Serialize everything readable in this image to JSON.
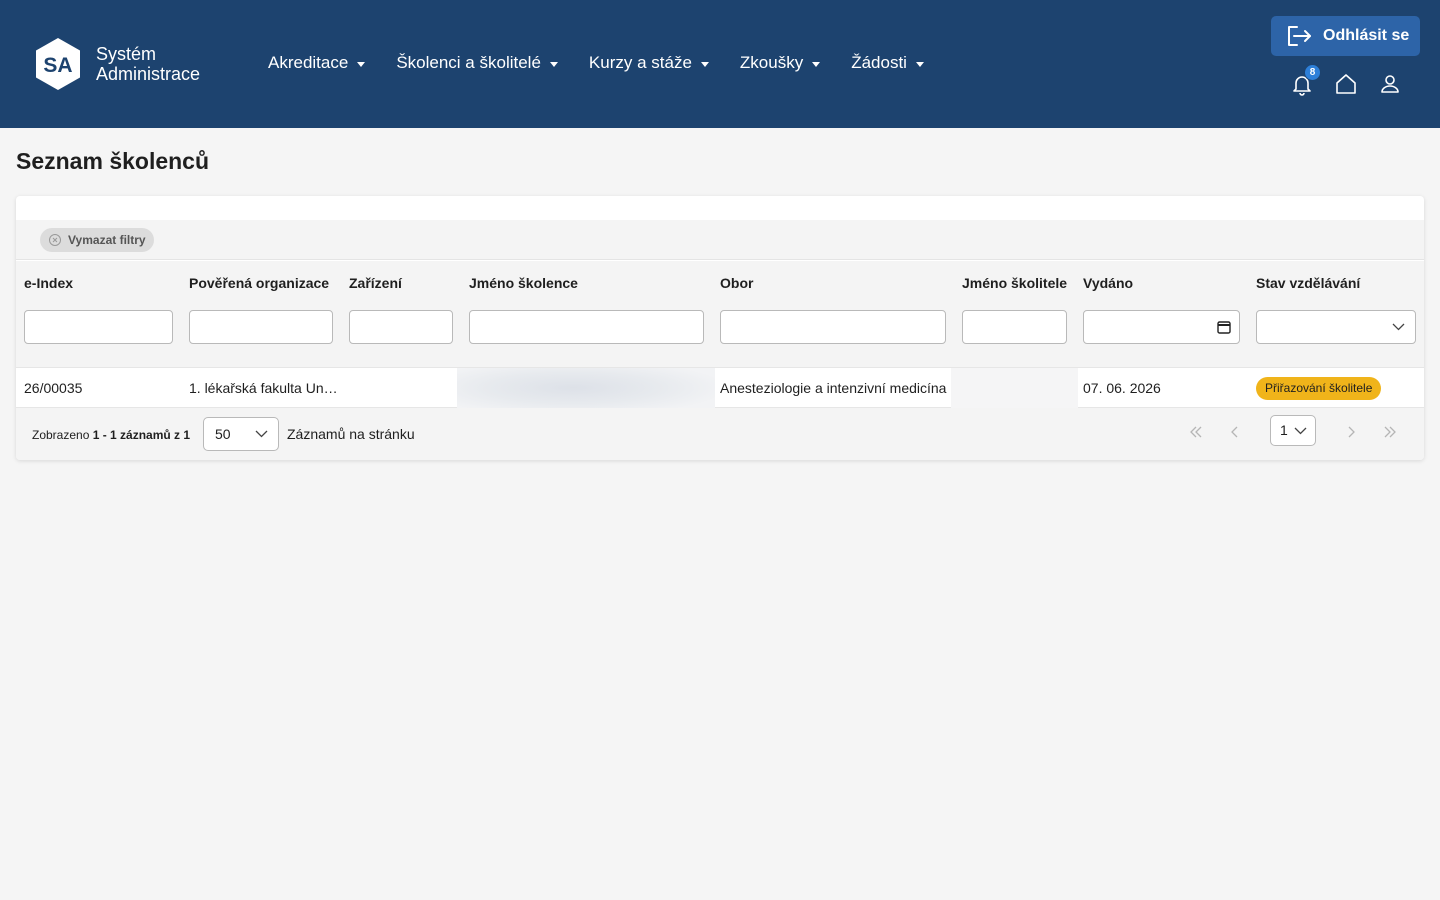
{
  "app": {
    "logo_text": "SA",
    "brand_line1": "Systém",
    "brand_line2": "Administrace"
  },
  "nav": [
    {
      "label": "Akreditace"
    },
    {
      "label": "Školenci a školitelé"
    },
    {
      "label": "Kurzy a stáže"
    },
    {
      "label": "Zkoušky"
    },
    {
      "label": "Žádosti"
    }
  ],
  "header": {
    "logout_label": "Odhlásit se",
    "notification_count": "8",
    "icons": [
      "bell-icon",
      "home-icon",
      "user-icon"
    ]
  },
  "page": {
    "title": "Seznam školenců"
  },
  "filters": {
    "clear_label": "Vymazat filtry",
    "date_placeholder": "",
    "status_value": ""
  },
  "table": {
    "columns": [
      "e-Index",
      "Pověřená organizace",
      "Zařízení",
      "Jméno školence",
      "Obor",
      "Jméno školitele",
      "Vydáno",
      "Stav vzdělávání"
    ],
    "rows": [
      {
        "eindex": "26/00035",
        "organizace": "1. lékařská fakulta Un…",
        "zarizeni": "",
        "jmeno": "",
        "obor": "Anesteziologie a intenzivní medicína",
        "skolitel": "",
        "vydano": "07. 06. 2026",
        "stav": "Přiřazování školitele"
      }
    ]
  },
  "pagination": {
    "shown_prefix": "Zobrazeno ",
    "shown_range": "1 - 1 záznamů z 1",
    "per_page": "50",
    "per_page_label": "Záznamů na stránku",
    "current_page": "1"
  },
  "colors": {
    "header_bg": "#1d436f",
    "logout_bg": "#2d64a8",
    "status_bg": "#f0b41a",
    "badge_bg": "#2d7fd8"
  }
}
